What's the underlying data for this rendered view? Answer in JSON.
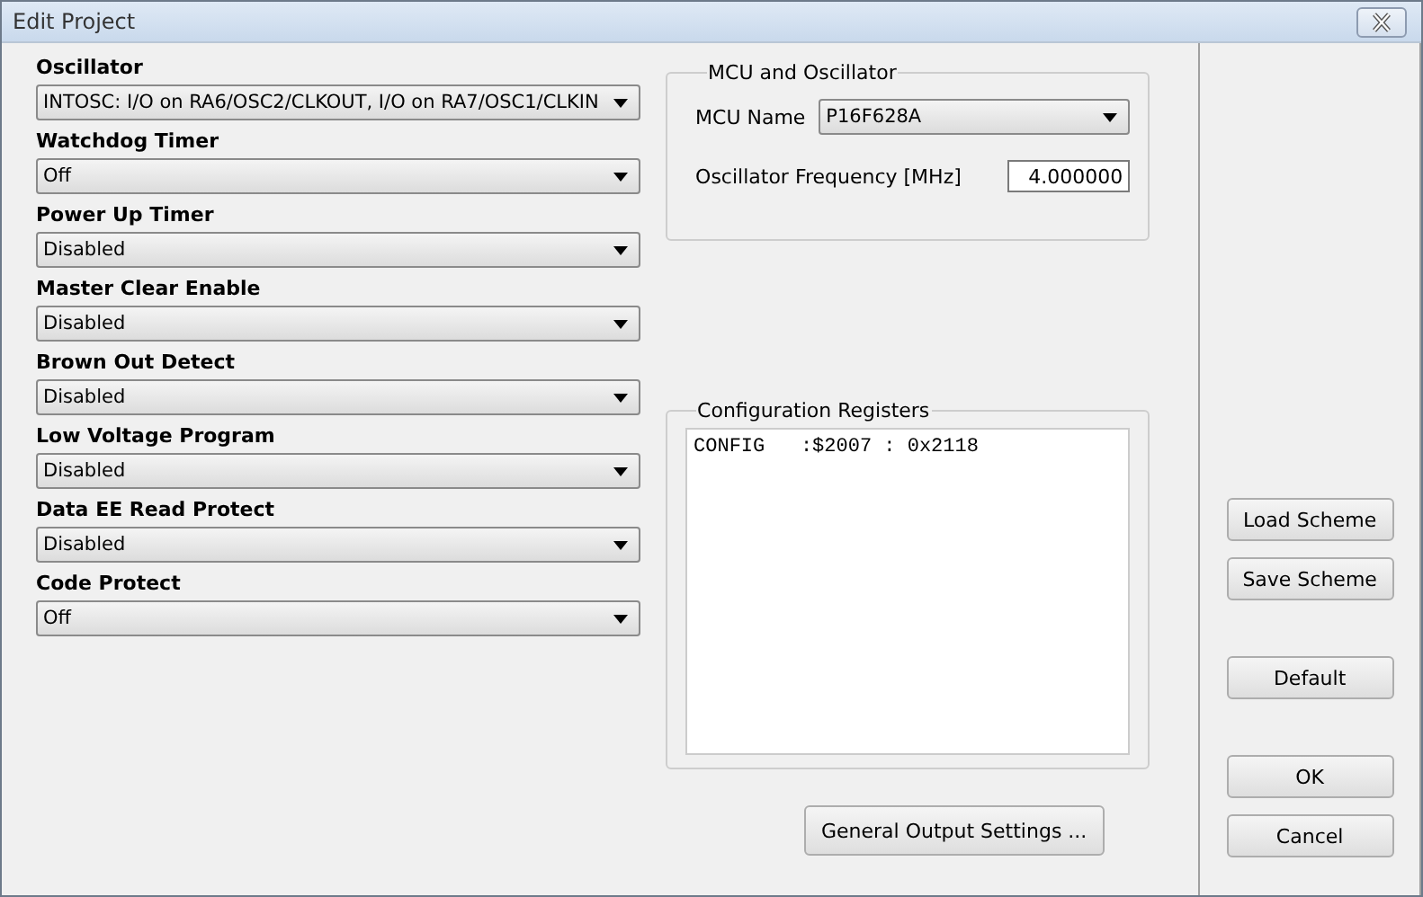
{
  "window": {
    "title": "Edit Project"
  },
  "settings": [
    {
      "label": "Oscillator",
      "value": "INTOSC: I/O on RA6/OSC2/CLKOUT, I/O on RA7/OSC1/CLKIN"
    },
    {
      "label": "Watchdog Timer",
      "value": "Off"
    },
    {
      "label": "Power Up Timer",
      "value": "Disabled"
    },
    {
      "label": "Master Clear Enable",
      "value": "Disabled"
    },
    {
      "label": "Brown Out Detect",
      "value": "Disabled"
    },
    {
      "label": "Low Voltage Program",
      "value": "Disabled"
    },
    {
      "label": "Data EE Read Protect",
      "value": "Disabled"
    },
    {
      "label": "Code Protect",
      "value": "Off"
    }
  ],
  "mcu_group": {
    "title": "MCU and Oscillator",
    "mcu_label": "MCU Name",
    "mcu_value": "P16F628A",
    "freq_label": "Oscillator Frequency [MHz]",
    "freq_value": "4.000000"
  },
  "config_group": {
    "title": "Configuration Registers",
    "text": "CONFIG   :$2007 : 0x2118"
  },
  "output_button": "General Output Settings ...",
  "side_button_groups": [
    [
      "Load Scheme",
      "Save Scheme"
    ],
    [
      "Default"
    ],
    [
      "OK",
      "Cancel"
    ]
  ]
}
